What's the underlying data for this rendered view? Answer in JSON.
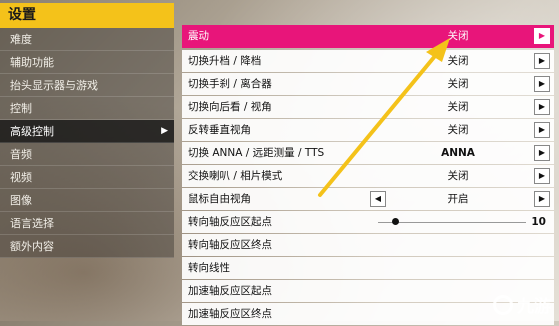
{
  "left": {
    "title": "设置",
    "items": [
      {
        "label": "难度"
      },
      {
        "label": "辅助功能"
      },
      {
        "label": "抬头显示器与游戏"
      },
      {
        "label": "控制"
      },
      {
        "label": "高级控制"
      },
      {
        "label": "音频"
      },
      {
        "label": "视频"
      },
      {
        "label": "图像"
      },
      {
        "label": "语言选择"
      },
      {
        "label": "额外内容"
      }
    ],
    "active_index": 4
  },
  "settings": {
    "rows": [
      {
        "label": "震动",
        "value": "关闭",
        "control": "right-arrow"
      },
      {
        "label": "切换升档 / 降档",
        "value": "关闭",
        "control": "right-arrow"
      },
      {
        "label": "切换手刹 / 离合器",
        "value": "关闭",
        "control": "right-arrow"
      },
      {
        "label": "切换向后看 / 视角",
        "value": "关闭",
        "control": "right-arrow"
      },
      {
        "label": "反转垂直视角",
        "value": "关闭",
        "control": "right-arrow"
      },
      {
        "label": "切换 ANNA / 远距测量 / TTS",
        "value": "ANNA",
        "control": "right-arrow"
      },
      {
        "label": "交换喇叭 / 相片模式",
        "value": "关闭",
        "control": "right-arrow"
      },
      {
        "label": "鼠标自由视角",
        "value": "开启",
        "control": "left-arrow"
      },
      {
        "label": "转向轴反应区起点",
        "value": "10",
        "control": "slider",
        "level": 0.1
      },
      {
        "label": "转向轴反应区终点",
        "value": "",
        "control": "none"
      },
      {
        "label": "转向线性",
        "value": "",
        "control": "none"
      },
      {
        "label": "加速轴反应区起点",
        "value": "",
        "control": "none"
      },
      {
        "label": "加速轴反应区终点",
        "value": "",
        "control": "none"
      }
    ]
  },
  "colors": {
    "accent": "#e8157a",
    "title_bar": "#f4c21a",
    "annotation": "#f4c21a"
  },
  "watermark": {
    "text": "九游"
  }
}
